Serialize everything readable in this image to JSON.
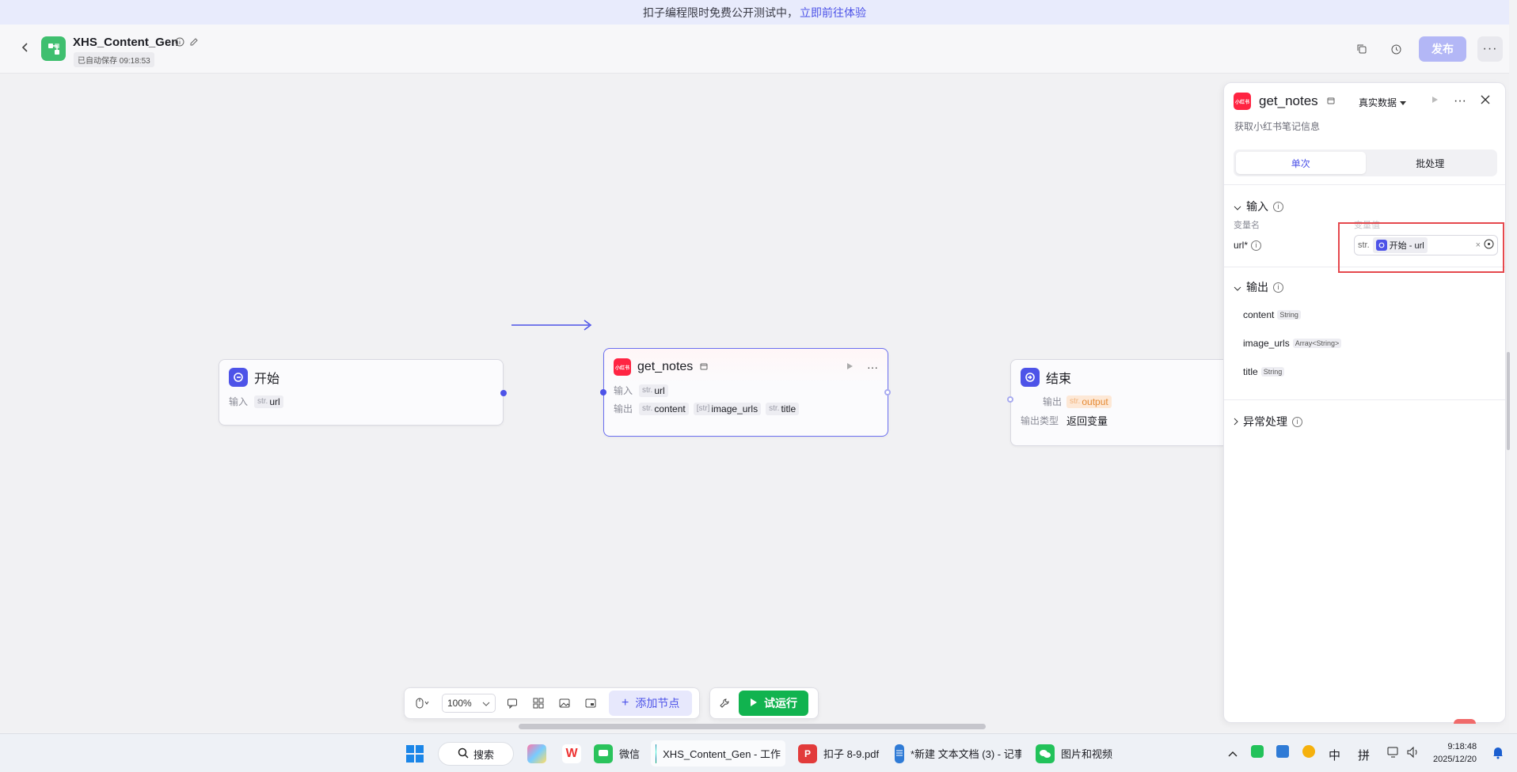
{
  "banner": {
    "text": "扣子编程限时免费公开测试中，",
    "link": "立即前往体验"
  },
  "header": {
    "title": "XHS_Content_Gen",
    "autosave": "已自动保存 09:18:53",
    "publish": "发布",
    "more": "···"
  },
  "nodes": {
    "start": {
      "title": "开始",
      "input_label": "输入",
      "input_type": "str.",
      "input_name": "url"
    },
    "get_notes": {
      "title": "get_notes",
      "badge": "小红书",
      "input_label": "输入",
      "input_type": "str.",
      "input_name": "url",
      "output_label": "输出",
      "outputs": [
        {
          "type": "str.",
          "name": "content"
        },
        {
          "type": "[str]",
          "name": "image_urls"
        },
        {
          "type": "str.",
          "name": "title"
        }
      ]
    },
    "end": {
      "title": "结束",
      "output_label": "输出",
      "output_type": "str.",
      "output_name": "output",
      "output_kind_label": "输出类型",
      "output_kind_value": "返回变量"
    }
  },
  "toolbar": {
    "zoom": "100%",
    "add_node": "添加节点",
    "run": "试运行"
  },
  "panel": {
    "title": "get_notes",
    "description": "获取小红书笔记信息",
    "data_mode": "真实数据",
    "tabs": [
      "单次",
      "批处理"
    ],
    "input_section": "输入",
    "col_varname": "变量名",
    "col_varvalue": "变量值",
    "url_label": "url*",
    "ref_type": "str.",
    "ref_value": "开始 - url",
    "output_section": "输出",
    "outputs": [
      {
        "name": "content",
        "type": "String"
      },
      {
        "name": "image_urls",
        "type": "Array<String>"
      },
      {
        "name": "title",
        "type": "String"
      }
    ],
    "error_section": "异常处理"
  },
  "taskbar": {
    "search": "搜索",
    "items": [
      {
        "label": "微信"
      },
      {
        "label": "XHS_Content_Gen - 工作"
      },
      {
        "label": "扣子 8-9.pdf"
      },
      {
        "label": "*新建 文本文档 (3) - 记事"
      },
      {
        "label": "图片和视频"
      }
    ],
    "ime1": "中",
    "ime2": "拼",
    "time": "9:18:48",
    "date": "2025/12/20"
  },
  "colors": {
    "accent": "#4d53e8",
    "run_green": "#11b34f",
    "highlight": "#e5484d",
    "redbook": "#ff2442"
  }
}
